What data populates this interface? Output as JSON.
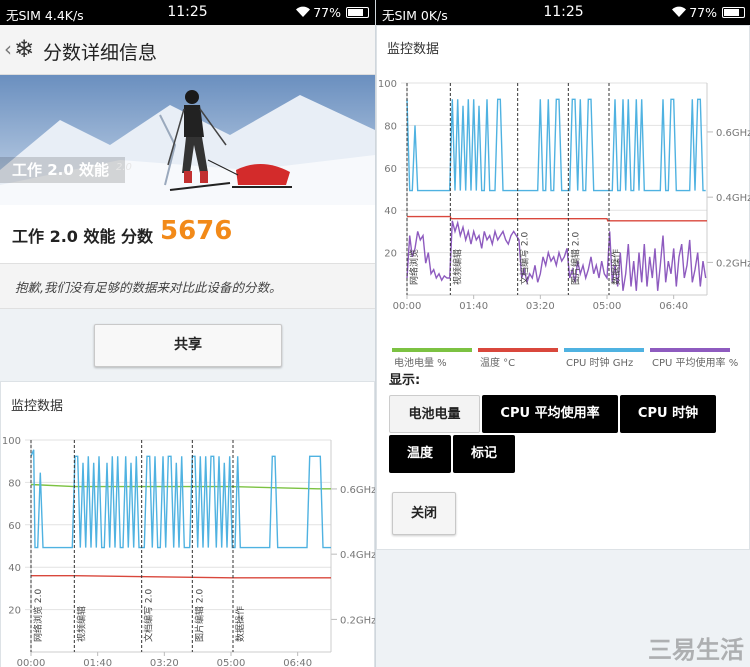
{
  "status_left": {
    "carrier": "无SIM",
    "speed": "4.4K/s",
    "time": "11:25",
    "battery": "77%",
    "battery_level": 0.77
  },
  "status_right": {
    "carrier": "无SIM",
    "speed": "0K/s",
    "time": "11:25",
    "battery": "77%",
    "battery_level": 0.77
  },
  "appbar": {
    "back_icon": "chevron-left-icon",
    "logo_icon": "snowflake-logo-icon",
    "title": "分数详细信息"
  },
  "hero": {
    "caption": "工作 2.0 效能",
    "version": "2.0"
  },
  "score": {
    "label": "工作 2.0 效能 分数",
    "value": "5676",
    "color": "#f28a19"
  },
  "note": "抱歉,我们没有足够的数据来对比此设备的分数。",
  "share_label": "共享",
  "monitor_title": "监控数据",
  "legend": [
    {
      "label": "电池电量 %",
      "color": "#7cc242"
    },
    {
      "label": "温度 °C",
      "color": "#d9473c"
    },
    {
      "label": "CPU 时钟 GHz",
      "color": "#4fb2e1"
    },
    {
      "label": "CPU 平均使用率 %",
      "color": "#8e5bbf"
    }
  ],
  "display": {
    "label": "显示:",
    "toggles": [
      {
        "label": "电池电量",
        "on": false
      },
      {
        "label": "CPU 平均使用率",
        "on": true
      },
      {
        "label": "CPU 时钟",
        "on": true
      },
      {
        "label": "温度",
        "on": true
      },
      {
        "label": "标记",
        "on": true
      }
    ]
  },
  "close_label": "关闭",
  "watermark": "三易生活",
  "chart_data": [
    {
      "type": "line",
      "x_ticks": [
        "00:00",
        "01:40",
        "03:20",
        "05:00",
        "06:40"
      ],
      "x_tick_values": [
        0,
        100,
        200,
        300,
        400
      ],
      "xlim": [
        0,
        450
      ],
      "y_ticks": [
        "20",
        "40",
        "60",
        "80",
        "100"
      ],
      "y_tick_values": [
        20,
        40,
        60,
        80,
        100
      ],
      "ylim": [
        0,
        100
      ],
      "y2_ticks": [
        "0.2GHz",
        "0.4GHz",
        "0.6GHz"
      ],
      "y2_tick_values": [
        0.2,
        0.4,
        0.6
      ],
      "y2lim": [
        0.1,
        0.75
      ],
      "markers": [
        {
          "x": 0,
          "label": "网络浏览 2.0"
        },
        {
          "x": 65,
          "label": "视频编辑"
        },
        {
          "x": 166,
          "label": "文档编写 2.0"
        },
        {
          "x": 242,
          "label": "图片编辑 2.0"
        },
        {
          "x": 303,
          "label": "数据操作"
        }
      ],
      "series": [
        {
          "name": "电池电量 %",
          "color": "#7cc242",
          "axis": "left",
          "x": [
            0,
            65,
            300,
            430,
            450
          ],
          "y": [
            79,
            78,
            78,
            77,
            77
          ]
        },
        {
          "name": "温度 °C",
          "color": "#d9473c",
          "axis": "left",
          "x": [
            0,
            65,
            66,
            300,
            301,
            450
          ],
          "y": [
            36,
            36,
            36,
            35,
            35,
            35
          ]
        },
        {
          "name": "CPU 时钟 GHz",
          "color": "#4fb2e1",
          "axis": "right",
          "x": [
            0,
            4,
            6,
            10,
            14,
            18,
            22,
            26,
            30,
            34,
            38,
            42,
            46,
            50,
            54,
            58,
            62,
            66,
            70,
            74,
            78,
            82,
            86,
            90,
            94,
            98,
            102,
            106,
            110,
            114,
            118,
            122,
            126,
            130,
            134,
            138,
            142,
            146,
            150,
            154,
            158,
            162,
            166,
            170,
            174,
            178,
            182,
            186,
            190,
            194,
            198,
            202,
            206,
            210,
            214,
            218,
            222,
            226,
            230,
            234,
            238,
            242,
            246,
            250,
            254,
            258,
            262,
            266,
            270,
            274,
            278,
            282,
            286,
            290,
            294,
            298,
            302,
            306,
            310,
            314,
            318,
            322,
            326,
            330,
            334,
            338,
            342,
            346,
            350,
            354,
            358,
            362,
            366,
            370,
            374,
            378,
            382,
            386,
            390,
            394,
            398,
            402,
            406,
            410,
            414,
            418,
            422,
            426,
            430,
            434,
            438,
            442,
            446,
            450
          ],
          "y": [
            0.7,
            0.72,
            0.42,
            0.42,
            0.65,
            0.42,
            0.42,
            0.42,
            0.42,
            0.42,
            0.42,
            0.42,
            0.42,
            0.42,
            0.42,
            0.42,
            0.42,
            0.7,
            0.7,
            0.42,
            0.68,
            0.42,
            0.7,
            0.42,
            0.68,
            0.42,
            0.7,
            0.42,
            0.42,
            0.68,
            0.42,
            0.7,
            0.42,
            0.7,
            0.42,
            0.42,
            0.7,
            0.42,
            0.68,
            0.42,
            0.7,
            0.42,
            0.42,
            0.42,
            0.7,
            0.7,
            0.42,
            0.7,
            0.42,
            0.42,
            0.7,
            0.42,
            0.7,
            0.7,
            0.42,
            0.68,
            0.42,
            0.7,
            0.42,
            0.42,
            0.42,
            0.7,
            0.7,
            0.42,
            0.7,
            0.42,
            0.7,
            0.42,
            0.7,
            0.7,
            0.42,
            0.7,
            0.42,
            0.68,
            0.42,
            0.7,
            0.42,
            0.42,
            0.7,
            0.42,
            0.42,
            0.42,
            0.42,
            0.42,
            0.42,
            0.42,
            0.42,
            0.42,
            0.42,
            0.42,
            0.42,
            0.7,
            0.7,
            0.42,
            0.42,
            0.42,
            0.42,
            0.42,
            0.42,
            0.42,
            0.42,
            0.42,
            0.42,
            0.42,
            0.42,
            0.7,
            0.7,
            0.7,
            0.7,
            0.7,
            0.42,
            0.42,
            0.42,
            0.42
          ]
        }
      ]
    },
    {
      "type": "line",
      "x_ticks": [
        "00:00",
        "01:40",
        "03:20",
        "05:00",
        "06:40"
      ],
      "x_tick_values": [
        0,
        100,
        200,
        300,
        400
      ],
      "xlim": [
        0,
        450
      ],
      "y_ticks": [
        "20",
        "40",
        "60",
        "80",
        "100"
      ],
      "y_tick_values": [
        20,
        40,
        60,
        80,
        100
      ],
      "ylim": [
        0,
        100
      ],
      "y2_ticks": [
        "0.2GHz",
        "0.4GHz",
        "0.6GHz"
      ],
      "y2_tick_values": [
        0.2,
        0.4,
        0.6
      ],
      "y2lim": [
        0.1,
        0.75
      ],
      "markers": [
        {
          "x": 0,
          "label": "网络浏览"
        },
        {
          "x": 65,
          "label": "视频编辑"
        },
        {
          "x": 166,
          "label": "文档编写 2.0"
        },
        {
          "x": 242,
          "label": "图片编辑 2.0"
        },
        {
          "x": 303,
          "label": "数据操作"
        }
      ],
      "series": [
        {
          "name": "温度 °C",
          "color": "#d9473c",
          "axis": "left",
          "x": [
            0,
            65,
            66,
            300,
            301,
            450
          ],
          "y": [
            37,
            37,
            36,
            36,
            35,
            35
          ]
        },
        {
          "name": "CPU 时钟 GHz",
          "color": "#4fb2e1",
          "axis": "right",
          "x": [
            0,
            4,
            8,
            12,
            16,
            20,
            24,
            28,
            32,
            36,
            40,
            44,
            48,
            52,
            56,
            60,
            64,
            68,
            72,
            76,
            80,
            84,
            88,
            92,
            96,
            100,
            104,
            108,
            112,
            116,
            120,
            124,
            128,
            132,
            136,
            140,
            144,
            148,
            152,
            156,
            160,
            164,
            168,
            172,
            176,
            180,
            184,
            188,
            192,
            196,
            200,
            204,
            208,
            212,
            216,
            220,
            224,
            228,
            232,
            236,
            240,
            244,
            248,
            252,
            256,
            260,
            264,
            268,
            272,
            276,
            280,
            284,
            288,
            292,
            296,
            300,
            304,
            308,
            312,
            316,
            320,
            324,
            328,
            332,
            336,
            340,
            344,
            348,
            352,
            356,
            360,
            364,
            368,
            372,
            376,
            380,
            384,
            388,
            392,
            396,
            400,
            404,
            408,
            412,
            416,
            420,
            424,
            428,
            432,
            436,
            440,
            444,
            448
          ],
          "y": [
            0.7,
            0.42,
            0.42,
            0.62,
            0.42,
            0.42,
            0.42,
            0.42,
            0.42,
            0.42,
            0.42,
            0.42,
            0.42,
            0.42,
            0.42,
            0.42,
            0.42,
            0.7,
            0.42,
            0.7,
            0.42,
            0.68,
            0.42,
            0.7,
            0.42,
            0.7,
            0.42,
            0.68,
            0.42,
            0.42,
            0.7,
            0.42,
            0.42,
            0.42,
            0.7,
            0.7,
            0.42,
            0.42,
            0.42,
            0.42,
            0.42,
            0.42,
            0.42,
            0.42,
            0.42,
            0.42,
            0.42,
            0.42,
            0.42,
            0.42,
            0.7,
            0.42,
            0.42,
            0.7,
            0.42,
            0.42,
            0.7,
            0.7,
            0.42,
            0.42,
            0.42,
            0.42,
            0.7,
            0.7,
            0.42,
            0.7,
            0.42,
            0.42,
            0.7,
            0.7,
            0.42,
            0.42,
            0.42,
            0.42,
            0.42,
            0.42,
            0.42,
            0.42,
            0.7,
            0.42,
            0.42,
            0.7,
            0.42,
            0.7,
            0.42,
            0.42,
            0.7,
            0.42,
            0.7,
            0.42,
            0.42,
            0.42,
            0.42,
            0.42,
            0.42,
            0.42,
            0.7,
            0.42,
            0.42,
            0.7,
            0.7,
            0.42,
            0.42,
            0.42,
            0.42,
            0.42,
            0.42,
            0.7,
            0.42,
            0.7,
            0.7,
            0.42,
            0.42
          ]
        },
        {
          "name": "CPU 平均使用率 %",
          "color": "#8e5bbf",
          "axis": "left",
          "x": [
            0,
            4,
            8,
            12,
            16,
            20,
            24,
            28,
            32,
            36,
            40,
            44,
            48,
            52,
            56,
            60,
            64,
            68,
            72,
            76,
            80,
            84,
            88,
            92,
            96,
            100,
            104,
            108,
            112,
            116,
            120,
            124,
            128,
            132,
            136,
            140,
            144,
            148,
            152,
            156,
            160,
            164,
            168,
            172,
            176,
            180,
            184,
            188,
            192,
            196,
            200,
            204,
            208,
            212,
            216,
            220,
            224,
            228,
            232,
            236,
            240,
            244,
            248,
            252,
            256,
            260,
            264,
            268,
            272,
            276,
            280,
            284,
            288,
            292,
            296,
            300,
            304,
            308,
            312,
            316,
            320,
            324,
            328,
            332,
            336,
            340,
            344,
            348,
            352,
            356,
            360,
            364,
            368,
            372,
            376,
            380,
            384,
            388,
            392,
            396,
            400,
            404,
            408,
            412,
            416,
            420,
            424,
            428,
            432,
            436,
            440,
            444,
            448
          ],
          "y": [
            8,
            28,
            18,
            22,
            30,
            26,
            28,
            15,
            20,
            10,
            12,
            8,
            10,
            7,
            9,
            8,
            8,
            35,
            30,
            34,
            28,
            32,
            26,
            30,
            24,
            30,
            26,
            28,
            22,
            30,
            26,
            28,
            24,
            30,
            26,
            28,
            30,
            26,
            24,
            28,
            30,
            28,
            26,
            8,
            12,
            6,
            10,
            8,
            14,
            6,
            10,
            18,
            14,
            20,
            16,
            18,
            14,
            20,
            16,
            18,
            22,
            8,
            12,
            6,
            16,
            10,
            14,
            8,
            12,
            18,
            10,
            14,
            8,
            16,
            10,
            8,
            30,
            6,
            14,
            4,
            20,
            2,
            10,
            24,
            4,
            16,
            2,
            20,
            6,
            24,
            4,
            18,
            8,
            22,
            2,
            14,
            28,
            6,
            16,
            10,
            22,
            4,
            18,
            24,
            8,
            14,
            26,
            6,
            12,
            20,
            4,
            16,
            8
          ]
        }
      ]
    }
  ]
}
